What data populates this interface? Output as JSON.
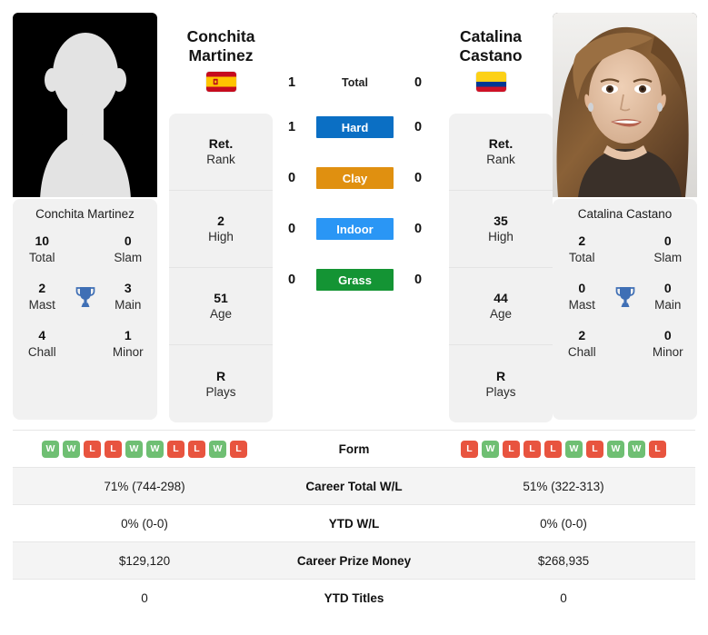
{
  "players": {
    "left": {
      "first_name": "Conchita",
      "last_name": "Martinez",
      "full_name": "Conchita Martinez",
      "country": "Spain",
      "flag_icon": "flag-spain",
      "photo_kind": "placeholder-avatar",
      "titles": {
        "total_num": "10",
        "total_label": "Total",
        "slam_num": "0",
        "slam_label": "Slam",
        "mast_num": "2",
        "mast_label": "Mast",
        "main_num": "3",
        "main_label": "Main",
        "chall_num": "4",
        "chall_label": "Chall",
        "minor_num": "1",
        "minor_label": "Minor"
      },
      "info": [
        {
          "value": "Ret.",
          "label": "Rank"
        },
        {
          "value": "2",
          "label": "High"
        },
        {
          "value": "51",
          "label": "Age"
        },
        {
          "value": "R",
          "label": "Plays"
        }
      ],
      "form": [
        "W",
        "W",
        "L",
        "L",
        "W",
        "W",
        "L",
        "L",
        "W",
        "L"
      ],
      "career_total_wl": "71% (744-298)",
      "ytd_wl": "0% (0-0)",
      "career_prize_money": "$129,120",
      "ytd_titles": "0"
    },
    "right": {
      "first_name": "Catalina",
      "last_name": "Castano",
      "full_name": "Catalina Castano",
      "country": "Colombia",
      "flag_icon": "flag-colombia",
      "photo_kind": "portrait-photo",
      "titles": {
        "total_num": "2",
        "total_label": "Total",
        "slam_num": "0",
        "slam_label": "Slam",
        "mast_num": "0",
        "mast_label": "Mast",
        "main_num": "0",
        "main_label": "Main",
        "chall_num": "2",
        "chall_label": "Chall",
        "minor_num": "0",
        "minor_label": "Minor"
      },
      "info": [
        {
          "value": "Ret.",
          "label": "Rank"
        },
        {
          "value": "35",
          "label": "High"
        },
        {
          "value": "44",
          "label": "Age"
        },
        {
          "value": "R",
          "label": "Plays"
        }
      ],
      "form": [
        "L",
        "W",
        "L",
        "L",
        "L",
        "W",
        "L",
        "W",
        "W",
        "L"
      ],
      "career_total_wl": "51% (322-313)",
      "ytd_wl": "0% (0-0)",
      "career_prize_money": "$268,935",
      "ytd_titles": "0"
    }
  },
  "head_to_head": [
    {
      "label": "Total",
      "left": "1",
      "right": "0",
      "color": ""
    },
    {
      "label": "Hard",
      "left": "1",
      "right": "0",
      "color": "#0b6fc4"
    },
    {
      "label": "Clay",
      "left": "0",
      "right": "0",
      "color": "#e09010"
    },
    {
      "label": "Indoor",
      "left": "0",
      "right": "0",
      "color": "#2a96f5"
    },
    {
      "label": "Grass",
      "left": "0",
      "right": "0",
      "color": "#149434"
    }
  ],
  "table": {
    "rows": [
      {
        "label": "Form",
        "type": "form"
      },
      {
        "label": "Career Total W/L",
        "type": "text",
        "key": "career_total_wl"
      },
      {
        "label": "YTD W/L",
        "type": "text",
        "key": "ytd_wl"
      },
      {
        "label": "Career Prize Money",
        "type": "text",
        "key": "career_prize_money"
      },
      {
        "label": "YTD Titles",
        "type": "text",
        "key": "ytd_titles"
      }
    ]
  },
  "colors": {
    "hard": "#0b6fc4",
    "clay": "#e09010",
    "indoor": "#2a96f5",
    "grass": "#149434",
    "win_badge": "#6fbf73",
    "loss_badge": "#e8543f",
    "card_bg": "#f1f1f1",
    "row_shade": "#f4f4f4"
  }
}
